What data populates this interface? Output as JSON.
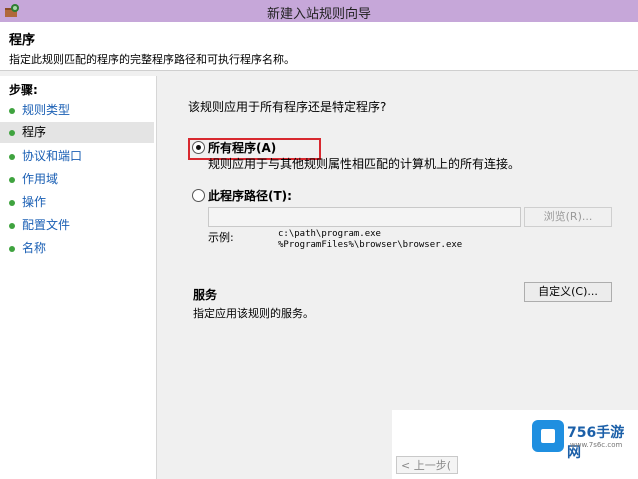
{
  "window": {
    "title": "新建入站规则向导",
    "titlebar_color": "#c6a7d9"
  },
  "header": {
    "title": "程序",
    "description": "指定此规则匹配的程序的完整程序路径和可执行程序名称。"
  },
  "sidebar": {
    "steps_title": "步骤:",
    "items": [
      {
        "label": "规则类型",
        "active": false
      },
      {
        "label": "程序",
        "active": true
      },
      {
        "label": "协议和端口",
        "active": false
      },
      {
        "label": "作用域",
        "active": false
      },
      {
        "label": "操作",
        "active": false
      },
      {
        "label": "配置文件",
        "active": false
      },
      {
        "label": "名称",
        "active": false
      }
    ]
  },
  "main": {
    "question": "该规则应用于所有程序还是特定程序?",
    "all_programs": {
      "label": "所有程序(A)",
      "description": "规则应用于与其他规则属性相匹配的计算机上的所有连接。",
      "selected": true
    },
    "program_path": {
      "label": "此程序路径(T):",
      "selected": false,
      "value": "",
      "browse_label": "浏览(R)...",
      "example_label": "示例:",
      "example_lines": [
        "c:\\path\\program.exe",
        "%ProgramFiles%\\browser\\browser.exe"
      ]
    },
    "services": {
      "title": "服务",
      "description": "指定应用该规则的服务。",
      "customize_label": "自定义(C)..."
    }
  },
  "footer": {
    "back_label": "< 上一步("
  },
  "watermark": {
    "text": "756手游网",
    "url": "www.7s6c.com"
  },
  "colors": {
    "highlight": "#d8282f",
    "link": "#1a5fb4",
    "step_dot": "#3fa33f"
  }
}
